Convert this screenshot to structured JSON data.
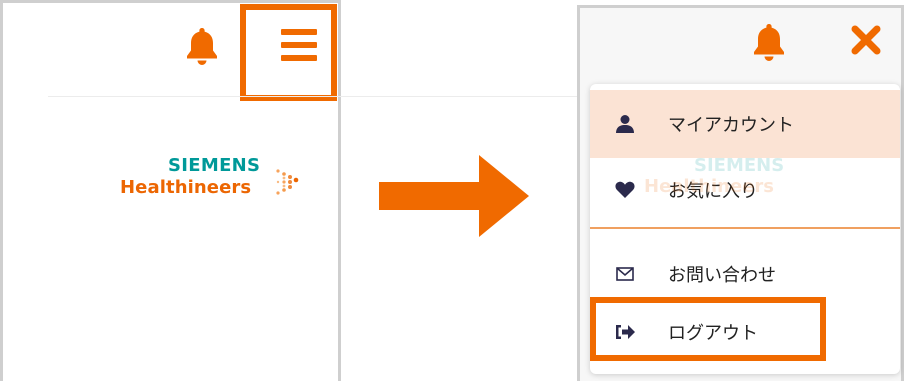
{
  "colors": {
    "accent": "#f06a00",
    "highlight_row": "#fbe3d4",
    "logo_teal": "#009999",
    "logo_orange": "#ec6602",
    "icon_dark": "#2b2a4c"
  },
  "before": {
    "icons": [
      "bell-icon",
      "hamburger-menu-icon"
    ],
    "logo": {
      "line1": "SIEMENS",
      "line2": "Healthineers"
    }
  },
  "after": {
    "icons": [
      "bell-icon",
      "close-icon"
    ],
    "menu": {
      "items": [
        {
          "label": "マイアカウント",
          "icon": "user-icon"
        },
        {
          "label": "お気に入り",
          "icon": "heart-icon"
        },
        {
          "label": "お問い合わせ",
          "icon": "envelope-icon"
        },
        {
          "label": "ログアウト",
          "icon": "sign-out-icon"
        }
      ]
    }
  }
}
